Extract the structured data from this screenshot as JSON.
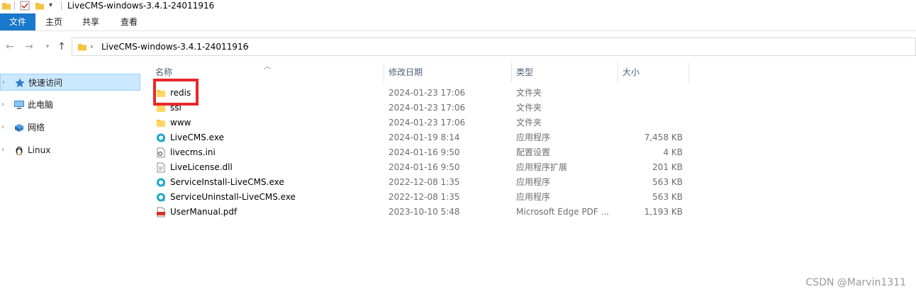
{
  "window": {
    "title": "LiveCMS-windows-3.4.1-24011916"
  },
  "ribbon": {
    "tabs": [
      "文件",
      "主页",
      "共享",
      "查看"
    ]
  },
  "address": {
    "path": "LiveCMS-windows-3.4.1-24011916"
  },
  "navpane": {
    "items": [
      {
        "label": "快速访问",
        "icon": "star-icon",
        "selected": true
      },
      {
        "label": "此电脑",
        "icon": "computer-icon"
      },
      {
        "label": "网络",
        "icon": "network-icon"
      },
      {
        "label": "Linux",
        "icon": "linux-icon"
      }
    ]
  },
  "columns": {
    "name": "名称",
    "date": "修改日期",
    "type": "类型",
    "size": "大小"
  },
  "files": [
    {
      "name": "redis",
      "date": "2024-01-23 17:06",
      "type": "文件夹",
      "size": "",
      "icon": "folder-icon"
    },
    {
      "name": "ssl",
      "date": "2024-01-23 17:06",
      "type": "文件夹",
      "size": "",
      "icon": "folder-icon"
    },
    {
      "name": "www",
      "date": "2024-01-23 17:06",
      "type": "文件夹",
      "size": "",
      "icon": "folder-icon"
    },
    {
      "name": "LiveCMS.exe",
      "date": "2024-01-19 8:14",
      "type": "应用程序",
      "size": "7,458 KB",
      "icon": "app-icon"
    },
    {
      "name": "livecms.ini",
      "date": "2024-01-16 9:50",
      "type": "配置设置",
      "size": "4 KB",
      "icon": "ini-icon"
    },
    {
      "name": "LiveLicense.dll",
      "date": "2024-01-16 9:50",
      "type": "应用程序扩展",
      "size": "201 KB",
      "icon": "dll-icon"
    },
    {
      "name": "ServiceInstall-LiveCMS.exe",
      "date": "2022-12-08 1:35",
      "type": "应用程序",
      "size": "563 KB",
      "icon": "app-icon"
    },
    {
      "name": "ServiceUninstall-LiveCMS.exe",
      "date": "2022-12-08 1:35",
      "type": "应用程序",
      "size": "563 KB",
      "icon": "app-icon"
    },
    {
      "name": "UserManual.pdf",
      "date": "2023-10-10 5:48",
      "type": "Microsoft Edge PDF ...",
      "size": "1,193 KB",
      "icon": "pdf-icon"
    }
  ],
  "colors": {
    "accent": "#1979ca",
    "highlight": "#e8272b",
    "selection": "#cce8ff",
    "folder": "#f5c542"
  },
  "watermark": "CSDN @Marvin1311"
}
